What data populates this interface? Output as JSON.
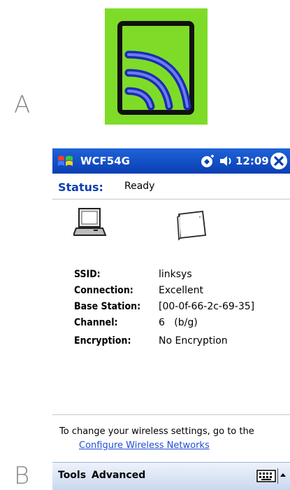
{
  "figure": {
    "label_a": "A",
    "label_b": "B"
  },
  "device": {
    "app_title": "WCF54G",
    "clock": "12:09",
    "status": {
      "label": "Status:",
      "value": "Ready"
    },
    "info": [
      {
        "key": "SSID:",
        "value": "linksys"
      },
      {
        "key": "Connection:",
        "value": "Excellent"
      },
      {
        "key": "Base Station:",
        "value": "[00-0f-66-2c-69-35]"
      },
      {
        "key": "Channel:",
        "value": "6   (b/g)"
      },
      {
        "key": "Encryption:",
        "value": "No Encryption"
      }
    ],
    "hint": {
      "text": "To change your wireless settings, go to the",
      "link": "Configure Wireless Networks"
    },
    "menu": {
      "tools": "Tools",
      "advanced": "Advanced"
    },
    "icons": {
      "app": "wifi-signal-icon",
      "start": "windows-flag-icon",
      "tray": "connectivity-icon",
      "volume": "speaker-icon",
      "close": "close-icon",
      "computer": "laptop-icon",
      "adapter": "wireless-card-icon",
      "keyboard": "keyboard-icon",
      "arrow": "chevron-up-icon"
    },
    "colors": {
      "titlebar": "#0a3fb3",
      "status_label": "#0d3fb3",
      "link": "#1f4fd6",
      "icon_bg": "#7edc28"
    }
  }
}
